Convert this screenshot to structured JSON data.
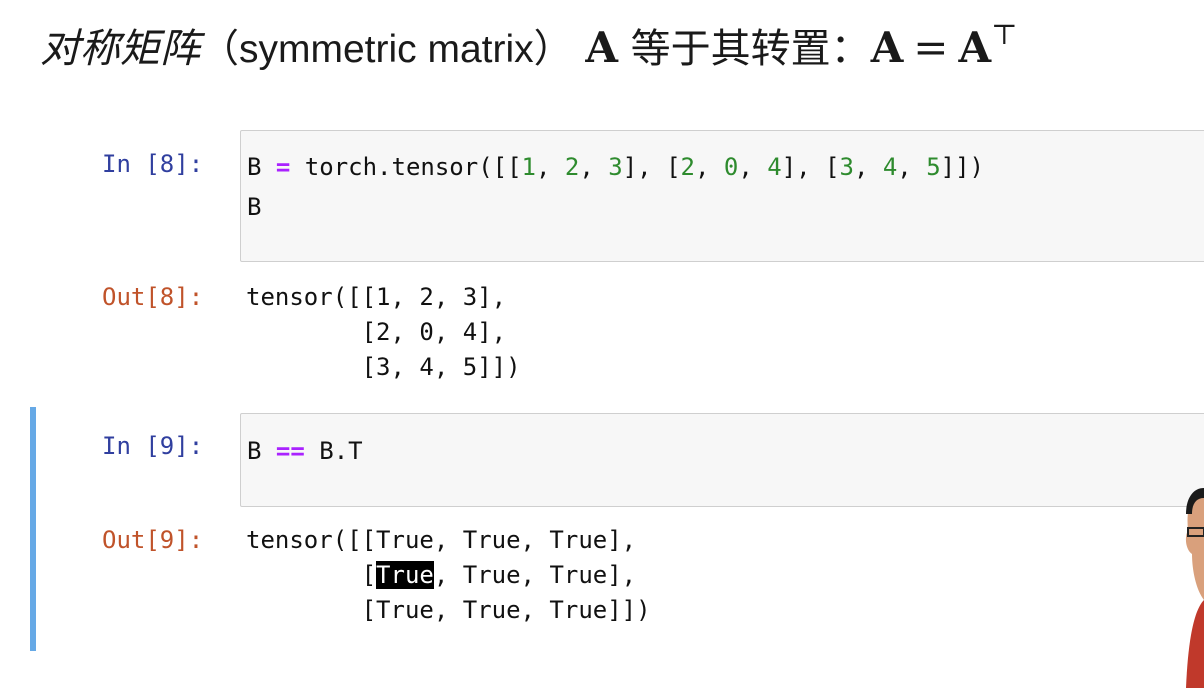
{
  "title": {
    "cn_prefix": "对称矩阵",
    "en_paren": "（symmetric matrix）",
    "symbol_a": "A",
    "cn_suffix": " 等于其转置：",
    "eq_left": "A",
    "eq_sign": "=",
    "eq_right": "A",
    "superscript": "⊤"
  },
  "cells": [
    {
      "in_prompt": "In [8]:",
      "code_line2": "B",
      "out_prompt": "Out[8]:",
      "output_lines": [
        "tensor([[1, 2, 3],",
        "        [2, 0, 4],",
        "        [3, 4, 5]])"
      ]
    },
    {
      "in_prompt": "In [9]:",
      "out_prompt": "Out[9]:",
      "output_line1": "tensor([[True, True, True],",
      "output_line2_pre": "        [",
      "output_line2_sel": "True",
      "output_line2_post": ", True, True],",
      "output_line3": "        [True, True, True]])"
    }
  ],
  "colors": {
    "in_prompt": "#303f9f",
    "out_prompt": "#c0532a",
    "selected_bar": "#66a9e6",
    "keyword_op": "#aa22ff",
    "number": "#2e8b2e"
  }
}
